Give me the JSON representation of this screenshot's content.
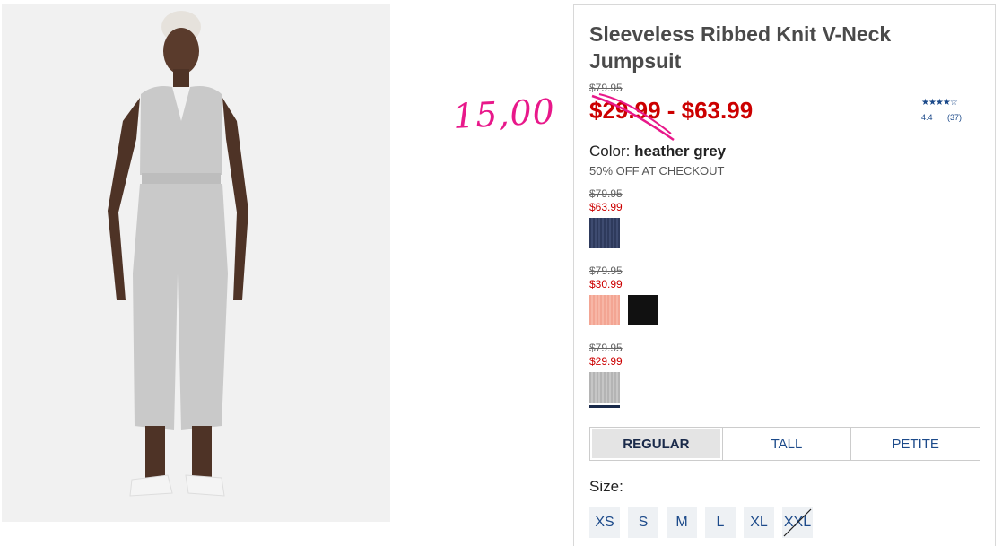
{
  "product": {
    "title": "Sleeveless Ribbed Knit V-Neck Jumpsuit",
    "original_price": "$79.95",
    "sale_price": "$29.99 - $63.99",
    "handwritten_note": "15,00"
  },
  "rating": {
    "stars": "★★★★☆",
    "score": "4.4",
    "count": "(37)"
  },
  "color": {
    "label": "Color:",
    "value": "heather grey",
    "promo": "50% OFF AT CHECKOUT"
  },
  "price_groups": [
    {
      "old": "$79.95",
      "new": "$63.99",
      "swatches": [
        {
          "name": "navy-heather",
          "color": "#2e3a5c"
        }
      ]
    },
    {
      "old": "$79.95",
      "new": "$30.99",
      "swatches": [
        {
          "name": "coral",
          "color": "#f3a593"
        },
        {
          "name": "black",
          "color": "#111111"
        }
      ]
    },
    {
      "old": "$79.95",
      "new": "$29.99",
      "swatches": [
        {
          "name": "heather-grey",
          "color": "#b9b9b9",
          "selected": true
        }
      ]
    }
  ],
  "fit": {
    "tabs": [
      "REGULAR",
      "TALL",
      "PETITE"
    ],
    "active": "REGULAR"
  },
  "size": {
    "label": "Size:",
    "options": [
      "XS",
      "S",
      "M",
      "L",
      "XL",
      "XXL"
    ],
    "unavailable": [
      "XXL"
    ]
  },
  "colors": {
    "sale_red": "#cc0000",
    "link_blue": "#1c4a8a",
    "annotation_pink": "#e8188a"
  }
}
